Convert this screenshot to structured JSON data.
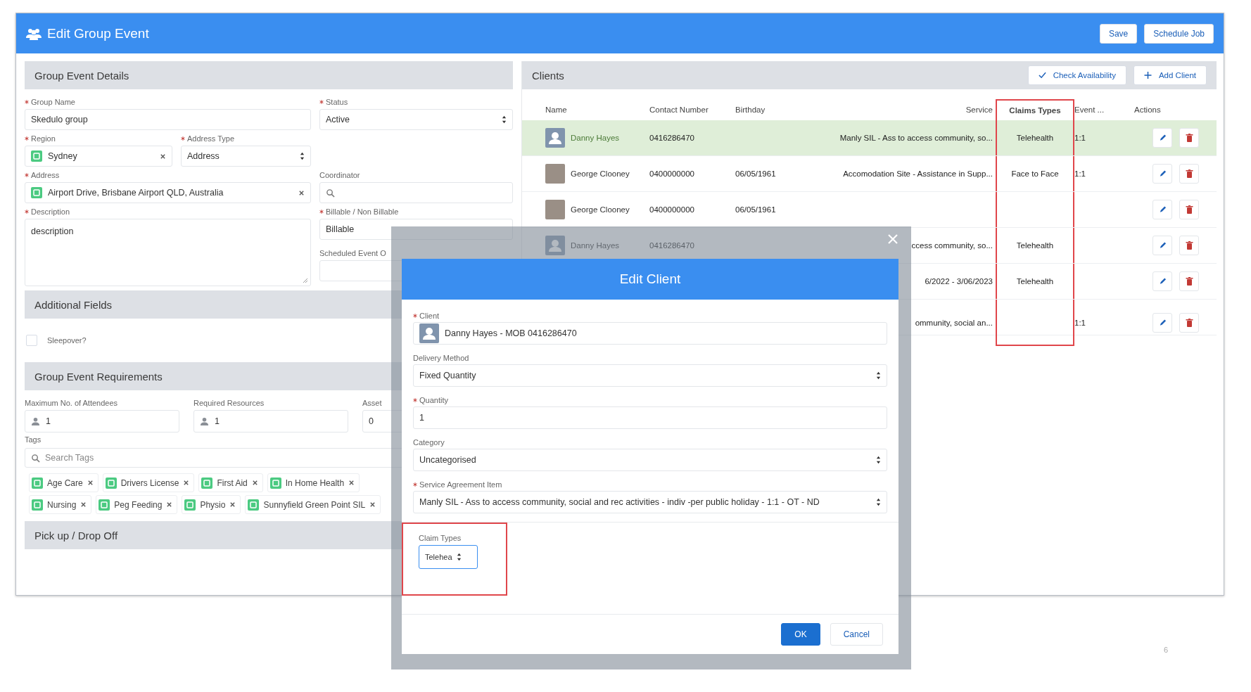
{
  "window": {
    "title": "Edit Group Event"
  },
  "header_buttons": [
    {
      "label": "Save"
    },
    {
      "label": "Schedule Job"
    }
  ],
  "details": {
    "title": "Group Event Details",
    "fields": [
      {
        "label": "Group Name",
        "required": true,
        "kind": "text",
        "value": "Skedulo group"
      },
      {
        "label": "Status",
        "required": true,
        "kind": "select",
        "value": "Active"
      },
      {
        "label": "Region",
        "required": true,
        "kind": "lookup",
        "value": "Sydney"
      },
      {
        "label": "Address Type",
        "required": true,
        "kind": "select",
        "value": "Address"
      },
      {
        "label": "Address",
        "required": true,
        "kind": "lookup",
        "value": "Airport Drive, Brisbane Airport QLD, Australia"
      },
      {
        "label": "Coordinator",
        "required": false,
        "kind": "search"
      },
      {
        "label": "Description",
        "required": true,
        "kind": "textarea",
        "value": "description"
      },
      {
        "label": "Billable / Non Billable",
        "required": true,
        "kind": "text",
        "value": "Billable"
      },
      {
        "label": "Scheduled Event O",
        "required": false,
        "kind": "text"
      }
    ]
  },
  "additional": {
    "title": "Additional Fields",
    "checkbox": {
      "label": "Sleepover?",
      "checked": false
    }
  },
  "requirements": {
    "title": "Group Event Requirements",
    "fields": [
      {
        "label": "Maximum No. of Attendees",
        "kind": "person",
        "value": "1"
      },
      {
        "label": "Required Resources",
        "kind": "person",
        "value": "1"
      },
      {
        "label": "Asset",
        "kind": "text",
        "value": "0"
      }
    ],
    "tags_label": "Tags",
    "tags_search": {
      "placeholder": "Search Tags"
    },
    "tags": [
      "Age Care",
      "Drivers License",
      "First Aid",
      "In Home Health",
      "Nursing",
      "Peg Feeding",
      "Physio",
      "Sunnyfield Green Point SIL"
    ]
  },
  "pickup": {
    "title": "Pick up / Drop Off"
  },
  "clients": {
    "title": "Clients",
    "buttons": [
      {
        "label": "Check Availability",
        "kind": "check"
      },
      {
        "label": "Add Client",
        "kind": "add"
      }
    ],
    "columns": [
      {
        "label": "Name",
        "highlighted": false
      },
      {
        "label": "Contact Number",
        "highlighted": false
      },
      {
        "label": "Birthday",
        "highlighted": false
      },
      {
        "label": "Service",
        "highlighted": false
      },
      {
        "label": "Claims Types",
        "highlighted": true
      },
      {
        "label": "Event ...",
        "highlighted": false
      },
      {
        "label": "Actions",
        "highlighted": false
      }
    ],
    "rows": [
      {
        "selected": true,
        "kind": "silhouette",
        "name": "Danny Hayes",
        "contact": "0416286470",
        "service": "Manly SIL - Ass to access community, so...",
        "claims": "Telehealth",
        "event": "1:1"
      },
      {
        "selected": false,
        "kind": "photo",
        "name": "George Clooney",
        "contact": "0400000000",
        "birthday": "06/05/1961",
        "service": "Accomodation Site - Assistance in Supp...",
        "claims": "Face to Face",
        "event": "1:1"
      },
      {
        "selected": false,
        "kind": "photo",
        "name": "George Clooney",
        "contact": "0400000000",
        "birthday": "06/05/1961"
      },
      {
        "selected": false,
        "kind": "silhouette",
        "name": "Danny Hayes",
        "contact": "0416286470",
        "service": "ccess community, so...",
        "claims": "Telehealth"
      },
      {
        "selected": false,
        "service": "6/2022 - 3/06/2023",
        "claims": "Telehealth"
      },
      {
        "selected": false,
        "service": "ommunity, social an...",
        "event": "1:1"
      }
    ]
  },
  "modal": {
    "title": "Edit Client",
    "fields": [
      {
        "label": "Client",
        "required": true,
        "kind": "client",
        "value": "Danny Hayes - MOB 0416286470"
      },
      {
        "label": "Delivery Method",
        "required": false,
        "kind": "select",
        "value": "Fixed Quantity"
      },
      {
        "label": "Quantity",
        "required": true,
        "kind": "text",
        "value": "1"
      },
      {
        "label": "Category",
        "required": false,
        "kind": "select",
        "value": "Uncategorised"
      },
      {
        "label": "Service Agreement Item",
        "required": true,
        "kind": "select",
        "value": "Manly SIL - Ass to access community, social and rec activities - indiv -per public holiday - 1:1 - OT - ND"
      }
    ],
    "claim_types": {
      "label": "Claim Types",
      "value": "Telehea",
      "highlighted": true
    },
    "buttons": [
      {
        "label": "OK",
        "primary": true
      },
      {
        "label": "Cancel",
        "primary": false
      }
    ]
  },
  "page_number": "6"
}
